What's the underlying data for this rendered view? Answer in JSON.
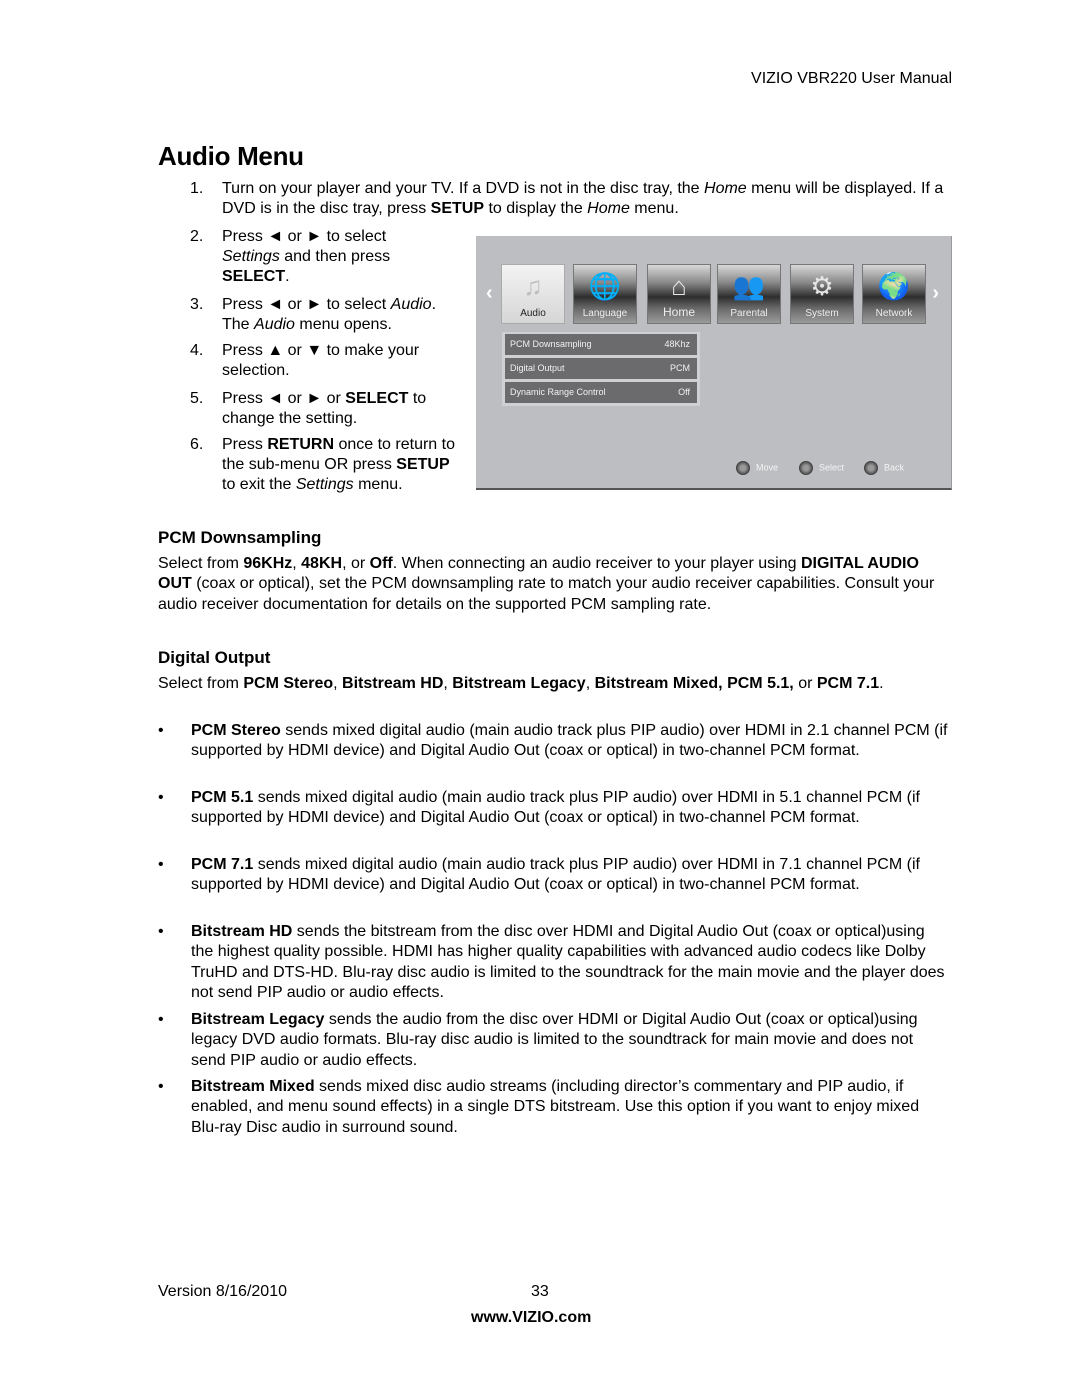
{
  "header": {
    "title": "VIZIO VBR220 User Manual"
  },
  "page_title": "Audio Menu",
  "steps": [
    {
      "num": "1.",
      "parts": [
        "Turn on your player and your TV. If a DVD is not in the disc tray, the ",
        "Home",
        " menu will be displayed. If a DVD is in the disc tray, press ",
        "SETUP",
        " to display the ",
        "Home",
        " menu."
      ]
    },
    {
      "num": "2.",
      "parts": [
        "Press ",
        "◄",
        " or ",
        "►",
        " to select ",
        "Settings",
        " and then press ",
        "SELECT",
        "."
      ]
    },
    {
      "num": "3.",
      "parts": [
        "Press ",
        "◄",
        " or ",
        "►",
        " to select ",
        "Audio",
        ".",
        "The ",
        "Audio",
        " menu opens."
      ]
    },
    {
      "num": "4.",
      "parts": [
        "Press ",
        "▲",
        " or ",
        "▼",
        " to make your selection."
      ]
    },
    {
      "num": "5.",
      "parts": [
        "Press ",
        "◄",
        " or ",
        "►",
        " or ",
        "SELECT",
        " to change the setting."
      ]
    },
    {
      "num": "6.",
      "parts": [
        "Press ",
        "RETURN",
        " once to return to the sub-menu OR press ",
        "SETUP",
        " to exit the ",
        "Settings",
        " menu."
      ]
    }
  ],
  "tv_menu": {
    "left_arrow": "‹",
    "right_arrow": "›",
    "tabs": [
      {
        "label": "Audio",
        "icon": "♫",
        "icon_name": "music-note-icon"
      },
      {
        "label": "Language",
        "icon": "🌐",
        "icon_name": "globe-icon"
      },
      {
        "label": "Home",
        "icon": "⌂",
        "icon_name": "house-icon"
      },
      {
        "label": "Parental",
        "icon": "👥",
        "icon_name": "people-icon"
      },
      {
        "label": "System",
        "icon": "⚙",
        "icon_name": "gears-icon"
      },
      {
        "label": "Network",
        "icon": "🌍",
        "icon_name": "network-globe-icon"
      }
    ],
    "settings": [
      {
        "label": "PCM Downsampling",
        "value": "48Khz"
      },
      {
        "label": "Digital Output",
        "value": "PCM"
      },
      {
        "label": "Dynamic Range Control",
        "value": "Off"
      }
    ],
    "hints": [
      "Move",
      "Select",
      "Back"
    ]
  },
  "sections": {
    "pcm_downsampling": {
      "heading": "PCM Downsampling",
      "parts": [
        "Select from ",
        "96KHz",
        ", ",
        "48KH",
        ", or ",
        "Off",
        ". When connecting an audio receiver to your player using ",
        "DIGITAL AUDIO OUT",
        " (coax or optical), set the PCM downsampling rate to match your audio receiver capabilities. Consult your audio receiver documentation for details on the supported PCM sampling rate."
      ]
    },
    "digital_output": {
      "heading": "Digital Output",
      "parts": [
        "Select from ",
        "PCM Stereo",
        ", ",
        "Bitstream HD",
        ", ",
        "Bitstream Legacy",
        ", ",
        "Bitstream Mixed, PCM 5.1,",
        " or ",
        "PCM 7.1",
        "."
      ],
      "bullets": [
        {
          "bold": "PCM Stereo",
          "text": " sends mixed digital audio (main audio track plus PIP audio) over HDMI in 2.1 channel PCM (if supported by HDMI device) and Digital Audio Out (coax or optical) in two-channel PCM format."
        },
        {
          "bold": "PCM 5.1",
          "text": " sends mixed digital audio (main audio track plus PIP audio) over HDMI in 5.1 channel PCM (if supported by HDMI device) and Digital Audio Out (coax or optical) in two-channel PCM format."
        },
        {
          "bold": "PCM 7.1",
          "text": " sends mixed digital audio (main audio track plus PIP audio) over HDMI in 7.1 channel PCM (if supported by HDMI device) and Digital Audio Out (coax or optical) in two-channel PCM format."
        },
        {
          "bold": "Bitstream HD",
          "text": " sends the bitstream from the disc over HDMI and Digital Audio Out (coax or optical)using the highest quality possible. HDMI has higher quality capabilities with advanced audio codecs like Dolby TruHD and DTS-HD. Blu-ray disc audio is limited to the soundtrack for the main movie and the player does not send PIP audio or audio effects."
        },
        {
          "bold": "Bitstream Legacy",
          "text": " sends the audio from the disc over HDMI or Digital Audio Out (coax or optical)using legacy DVD audio formats. Blu-ray disc audio is limited to the soundtrack for main movie and does not send PIP audio or audio effects."
        },
        {
          "bold": "Bitstream Mixed",
          "text": " sends mixed disc audio streams (including director’s commentary and PIP audio, if enabled, and menu sound effects) in a single DTS bitstream. Use this option if you want to enjoy mixed Blu-ray Disc audio in surround sound."
        }
      ]
    }
  },
  "footer": {
    "version": "Version 8/16/2010",
    "page_number": "33",
    "url": "www.VIZIO.com"
  }
}
